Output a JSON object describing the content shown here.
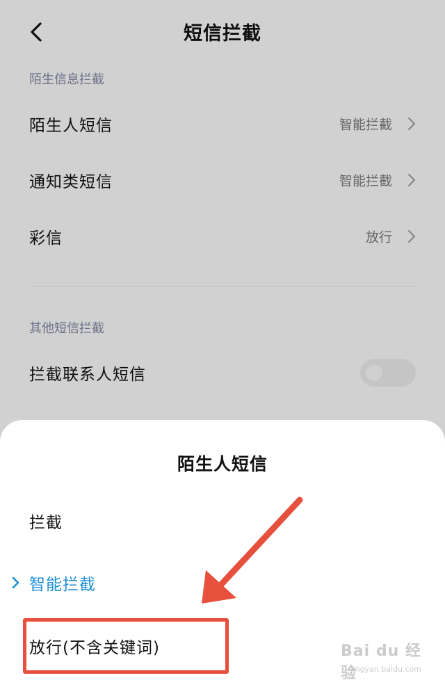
{
  "header": {
    "title": "短信拦截"
  },
  "sections": {
    "stranger": {
      "label": "陌生信息拦截",
      "items": [
        {
          "label": "陌生人短信",
          "value": "智能拦截"
        },
        {
          "label": "通知类短信",
          "value": "智能拦截"
        },
        {
          "label": "彩信",
          "value": "放行"
        }
      ]
    },
    "other": {
      "label": "其他短信拦截",
      "items": [
        {
          "label": "拦截联系人短信",
          "toggle_on": false
        }
      ]
    }
  },
  "sheet": {
    "title": "陌生人短信",
    "options": [
      {
        "label": "拦截",
        "selected": false
      },
      {
        "label": "智能拦截",
        "selected": true
      },
      {
        "label": "放行(不含关键词)",
        "selected": false
      }
    ]
  },
  "annotation": {
    "color": "#e8503e"
  },
  "watermark": {
    "main": "Bai du 经验",
    "sub": "jingyan.baidu.com"
  },
  "colors": {
    "accent": "#1e8fd6",
    "section_label": "#7f83a0"
  }
}
